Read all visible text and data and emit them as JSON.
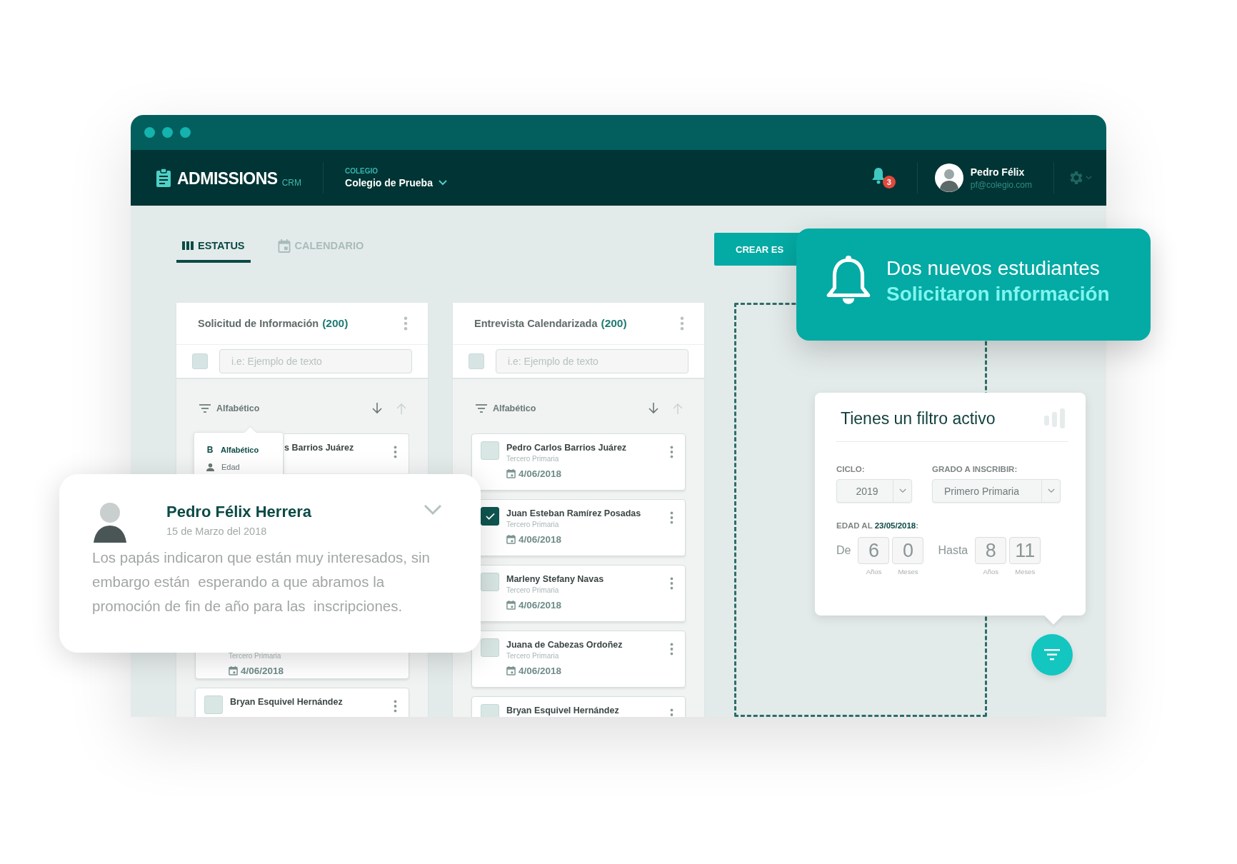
{
  "header": {
    "logo": {
      "name": "ADMISSIONS",
      "suffix": "CRM"
    },
    "school": {
      "label": "COLEGIO",
      "value": "Colegio de Prueba"
    },
    "notifications": {
      "count": "3"
    },
    "user": {
      "name": "Pedro Félix",
      "email": "pf@colegio.com"
    }
  },
  "tabs": [
    {
      "label": "ESTATUS",
      "selected": true
    },
    {
      "label": "CALENDARIO",
      "selected": false
    }
  ],
  "create_button": {
    "label": "CREAR ES"
  },
  "columns": [
    {
      "title": "Solicitud de Información",
      "count": "(200)",
      "search": {
        "placeholder": "i.e: Ejemplo de texto",
        "checked": false
      },
      "sort": {
        "label": "Alfabético"
      },
      "cards": [
        {
          "kind": "covered",
          "name": "s Barrios Juárez"
        },
        {
          "kind": "lower",
          "subtitle": "Tercero Primaria",
          "date": "4/06/2018"
        },
        {
          "kind": "top",
          "name": "Bryan Esquivel Hernández",
          "checked": false
        }
      ]
    },
    {
      "title": "Entrevista Calendarizada",
      "count": "(200)",
      "search": {
        "placeholder": "i.e: Ejemplo de texto",
        "checked": false
      },
      "sort": {
        "label": "Alfabético"
      },
      "cards": [
        {
          "kind": "full",
          "name": "Pedro Carlos Barrios Juárez",
          "subtitle": "Tercero Primaria",
          "date": "4/06/2018",
          "checked": false
        },
        {
          "kind": "full",
          "name": "Juan Esteban Ramírez Posadas",
          "subtitle": "Tercero Primaria",
          "date": "4/06/2018",
          "checked": true
        },
        {
          "kind": "full",
          "name": "Marleny Stefany Navas",
          "subtitle": "Tercero Primaria",
          "date": "4/06/2018",
          "checked": false
        },
        {
          "kind": "full",
          "name": "Juana de Cabezas Ordoñez",
          "subtitle": "Tercero Primaria",
          "date": "4/06/2018",
          "checked": false
        },
        {
          "kind": "top",
          "name": "Bryan Esquivel Hernández",
          "checked": false
        }
      ]
    }
  ],
  "sort_menu": {
    "items": [
      {
        "kind": "letter",
        "glyph": "B",
        "label": "Alfabético",
        "selected": true
      },
      {
        "kind": "person",
        "label": "Edad",
        "selected": false
      }
    ]
  },
  "comment": {
    "author": "Pedro Félix Herrera",
    "date": "15 de Marzo del 2018",
    "text": "Los papás indicaron que están muy interesados, sin embargo están  esperando a que abramos la promoción de fin de año para las  inscripciones."
  },
  "notification": {
    "line1": "Dos nuevos estudiantes",
    "line2": "Solicitaron información"
  },
  "filter": {
    "title": "Tienes un filtro activo",
    "cycle": {
      "label": "CICLO:",
      "value": "2019"
    },
    "grade": {
      "label": "GRADO A INSCRIBIR:",
      "value": "Primero Primaria"
    },
    "age_label": "EDAD AL **23/05/2018**:",
    "ranges": [
      {
        "label": "De",
        "years": "6",
        "years_label": "Años",
        "months": "0",
        "months_label": "Meses"
      },
      {
        "label": "Hasta",
        "years": "8",
        "years_label": "Años",
        "months": "11",
        "months_label": "Meses"
      }
    ]
  }
}
